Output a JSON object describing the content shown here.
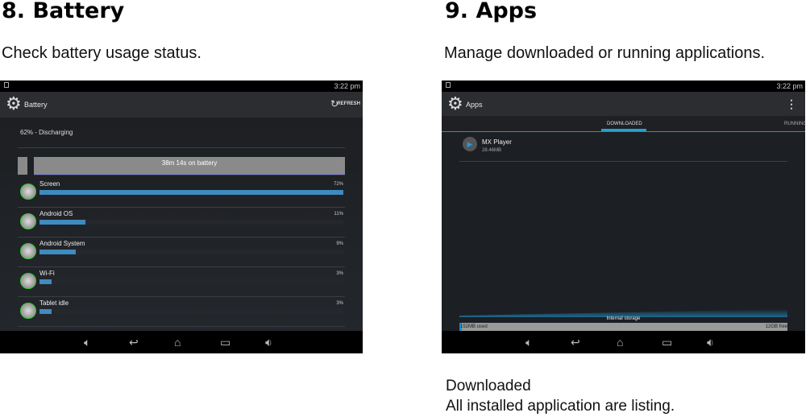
{
  "left": {
    "heading": "8. Battery",
    "desc": "Check battery usage status.",
    "status_time": "3:22 pm",
    "title": "Battery",
    "refresh": "REFRESH",
    "status_line": "62% - Discharging",
    "graph_label": "38m 14s on battery",
    "items": [
      {
        "name": "Screen",
        "pct": "72%",
        "value": 100
      },
      {
        "name": "Android OS",
        "pct": "11%",
        "value": 15
      },
      {
        "name": "Android System",
        "pct": "9%",
        "value": 12
      },
      {
        "name": "Wi-Fi",
        "pct": "3%",
        "value": 4
      },
      {
        "name": "Tablet idle",
        "pct": "3%",
        "value": 4
      }
    ]
  },
  "right": {
    "heading": "9. Apps",
    "desc": "Manage downloaded or running applications.",
    "status_time": "3:22 pm",
    "title": "Apps",
    "tabs": [
      "DOWNLOADED",
      "RUNNING"
    ],
    "app": {
      "name": "MX Player",
      "size": "28.46MB"
    },
    "storage_label": "Internal storage",
    "used": "152MB used",
    "free": "12GB free",
    "caption1": "Downloaded",
    "caption2": "All installed application are listing."
  },
  "nav_icons": [
    "volume-down-icon",
    "back-icon",
    "home-icon",
    "recents-icon",
    "volume-up-icon"
  ]
}
